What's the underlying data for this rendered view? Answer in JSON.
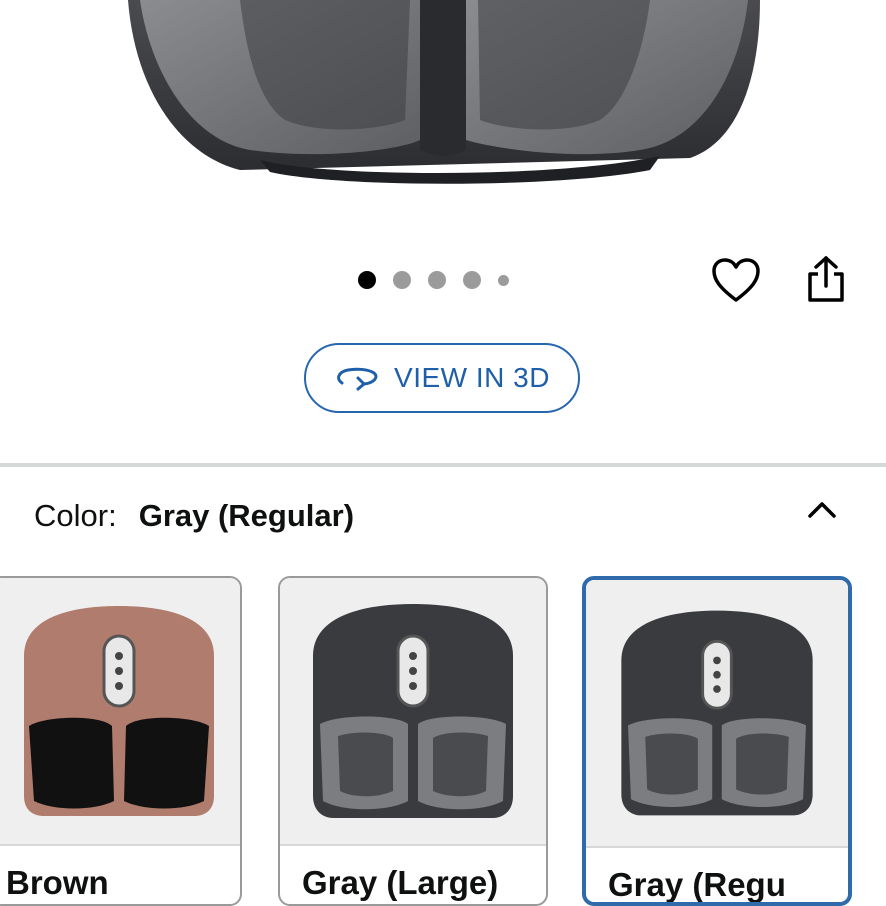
{
  "gallery": {
    "page_count": 5,
    "active_index": 0
  },
  "actions": {
    "favorite_icon": "heart-icon",
    "share_icon": "share-icon"
  },
  "view3d": {
    "label": "VIEW IN 3D",
    "icon": "rotate-3d-icon",
    "accent": "#2767b0"
  },
  "color_selector": {
    "label": "Color:",
    "selected_value": "Gray (Regular)",
    "toggle_icon": "chevron-up-icon",
    "options": [
      {
        "name": "Brown",
        "selected": false,
        "body_color": "#b07c6d"
      },
      {
        "name": "Gray (Large)",
        "selected": false,
        "body_color": "#3a3b3e"
      },
      {
        "name": "Gray (Regu",
        "selected": true,
        "body_color": "#3a3b3e"
      }
    ],
    "selected_border_color": "#2f6bab"
  }
}
